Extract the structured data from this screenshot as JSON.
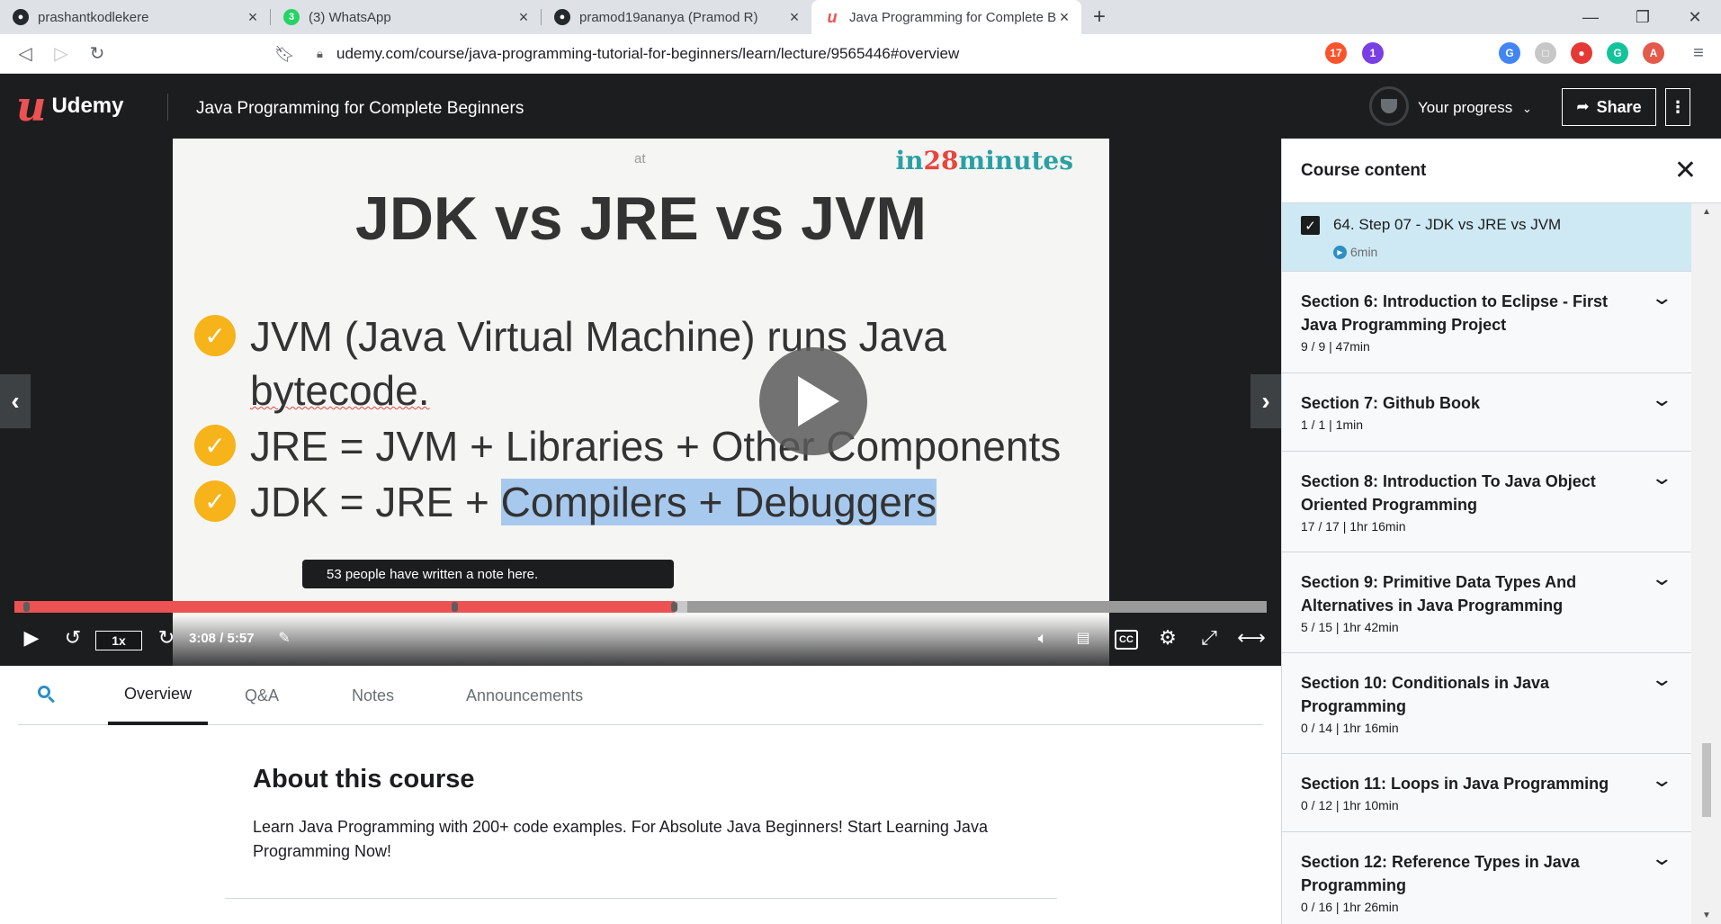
{
  "browser": {
    "tabs": [
      {
        "title": "prashantkodlekere",
        "favicon": "github-icon"
      },
      {
        "title": "(3) WhatsApp",
        "favicon": "whatsapp-icon",
        "badge": "3"
      },
      {
        "title": "pramod19ananya (Pramod R)",
        "favicon": "github-icon"
      },
      {
        "title": "Java Programming for Complete B",
        "favicon": "udemy-icon",
        "active": true
      }
    ],
    "url": "udemy.com/course/java-programming-tutorial-for-beginners/learn/lecture/9565446#overview",
    "extension_badges": [
      "17",
      "1"
    ]
  },
  "header": {
    "logo_text": "Udemy",
    "course_title": "Java Programming for Complete Beginners",
    "progress_label": "Your progress",
    "share_label": "Share"
  },
  "video": {
    "slide": {
      "at": "at",
      "brand_prefix": "in",
      "brand_number": "28",
      "brand_suffix": "minutes",
      "heading": "JDK vs JRE vs JVM",
      "bullet1_line1": "JVM (Java Virtual Machine) runs Java",
      "bullet1_line2": "bytecode.",
      "bullet2": "JRE = JVM + Libraries + Other Components",
      "bullet3_pre": "JDK = JRE + ",
      "bullet3_highlight": "Compilers + Debuggers"
    },
    "note_tooltip": "53 people have written a note here.",
    "speed": "1x",
    "time": "3:08 / 5:57",
    "progress_fraction": 0.527,
    "buffer_fraction": 0.537,
    "cc_label": "CC"
  },
  "lower_tabs": [
    "Overview",
    "Q&A",
    "Notes",
    "Announcements"
  ],
  "about": {
    "title": "About this course",
    "description": "Learn Java Programming with 200+ code examples. For Absolute Java Beginners! Start Learning Java Programming Now!"
  },
  "sidebar": {
    "title": "Course content",
    "current_lecture": {
      "title": "64. Step 07 - JDK vs JRE vs JVM",
      "duration": "6min"
    },
    "sections": [
      {
        "title": "Section 6: Introduction to Eclipse - First Java Programming Project",
        "meta": "9 / 9 | 47min"
      },
      {
        "title": "Section 7: Github Book",
        "meta": "1 / 1 | 1min"
      },
      {
        "title": "Section 8: Introduction To Java Object Oriented Programming",
        "meta": "17 / 17 | 1hr 16min"
      },
      {
        "title": "Section 9: Primitive Data Types And Alternatives in Java Programming",
        "meta": "5 / 15 | 1hr 42min"
      },
      {
        "title": "Section 10: Conditionals in Java Programming",
        "meta": "0 / 14 | 1hr 16min"
      },
      {
        "title": "Section 11: Loops in Java Programming",
        "meta": "0 / 12 | 1hr 10min"
      },
      {
        "title": "Section 12: Reference Types in Java Programming",
        "meta": "0 / 16 | 1hr 26min"
      }
    ]
  }
}
